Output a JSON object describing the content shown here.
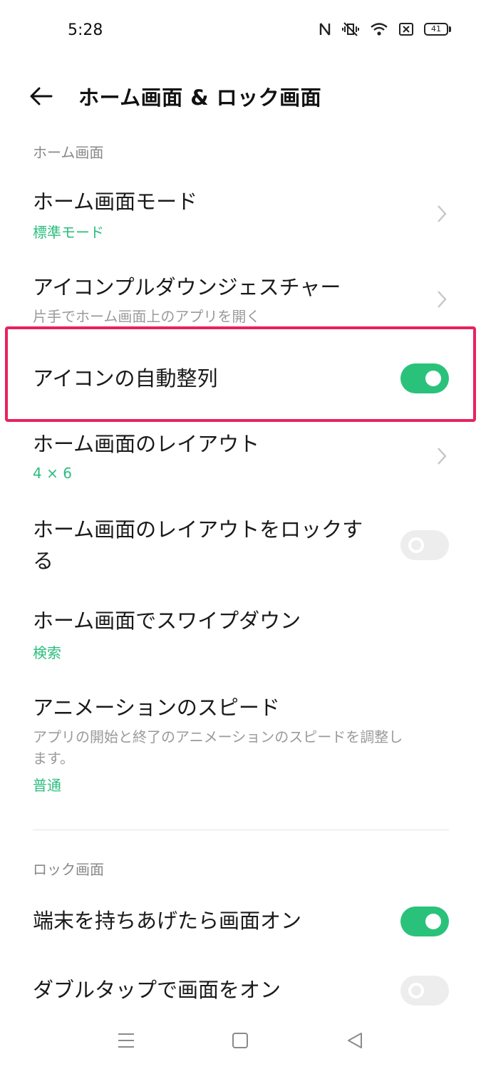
{
  "status_bar": {
    "time": "5:28",
    "icons": [
      "nfc-icon",
      "vibrate-mute-icon",
      "wifi-icon",
      "sim-blocked-icon",
      "battery-icon"
    ],
    "battery_level": "41"
  },
  "header": {
    "back_icon": "back-arrow-icon",
    "title": "ホーム画面 & ロック画面"
  },
  "sections": {
    "home": {
      "header": "ホーム画面",
      "items": [
        {
          "title": "ホーム画面モード",
          "subtitle": "標準モード"
        },
        {
          "title": "アイコンプルダウンジェスチャー",
          "description": "片手でホーム画面上のアプリを開く"
        },
        {
          "title": "アイコンの自動整列",
          "toggle": true
        },
        {
          "title": "ホーム画面のレイアウト",
          "subtitle": "4 × 6"
        },
        {
          "title_line1": "ホーム画面のレイアウトをロックす",
          "title_line2": "る",
          "toggle": false
        },
        {
          "title": "ホーム画面でスワイプダウン",
          "subtitle": "検索"
        },
        {
          "title": "アニメーションのスピード",
          "description_line1": "アプリの開始と終了のアニメーションのスピードを調整し",
          "description_line2": "ます。",
          "subtitle": "普通"
        }
      ]
    },
    "lock": {
      "header": "ロック画面",
      "items": [
        {
          "title": "端末を持ちあげたら画面オン",
          "toggle": true
        },
        {
          "title": "ダブルタップで画面をオン",
          "toggle": false
        }
      ]
    }
  },
  "colors": {
    "accent_green": "#2ac27a",
    "highlight_border": "#e8225e",
    "toggle_off": "#ededed"
  },
  "nav_bar": {
    "icons": [
      "menu-lines-icon",
      "home-square-icon",
      "back-triangle-icon"
    ]
  }
}
